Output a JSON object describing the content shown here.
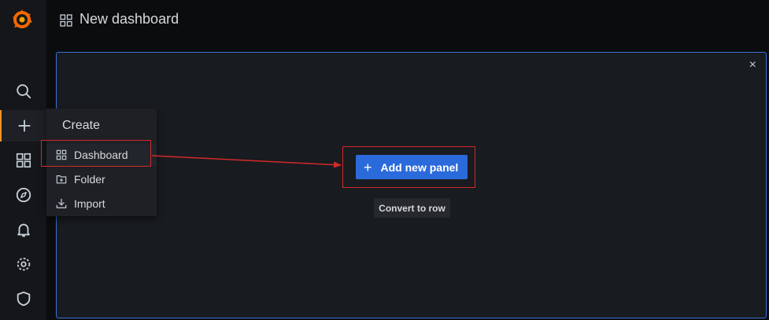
{
  "header": {
    "title": "New dashboard"
  },
  "sidebar": {
    "icons": [
      "grafana-logo",
      "search-icon",
      "plus-icon",
      "dashboards-icon",
      "explore-icon",
      "alerting-icon",
      "settings-icon",
      "shield-icon"
    ]
  },
  "create_menu": {
    "header": "Create",
    "items": [
      {
        "label": "Dashboard",
        "icon": "dashboards-icon"
      },
      {
        "label": "Folder",
        "icon": "folder-plus-icon"
      },
      {
        "label": "Import",
        "icon": "import-icon"
      }
    ]
  },
  "panel": {
    "add_panel_label": "Add new panel",
    "convert_label": "Convert to row",
    "close_symbol": "×"
  },
  "colors": {
    "accent": "#3d71d9",
    "primary_button": "#2b6adb",
    "annotation": "#d22a2a",
    "active_indicator": "#f79420"
  }
}
